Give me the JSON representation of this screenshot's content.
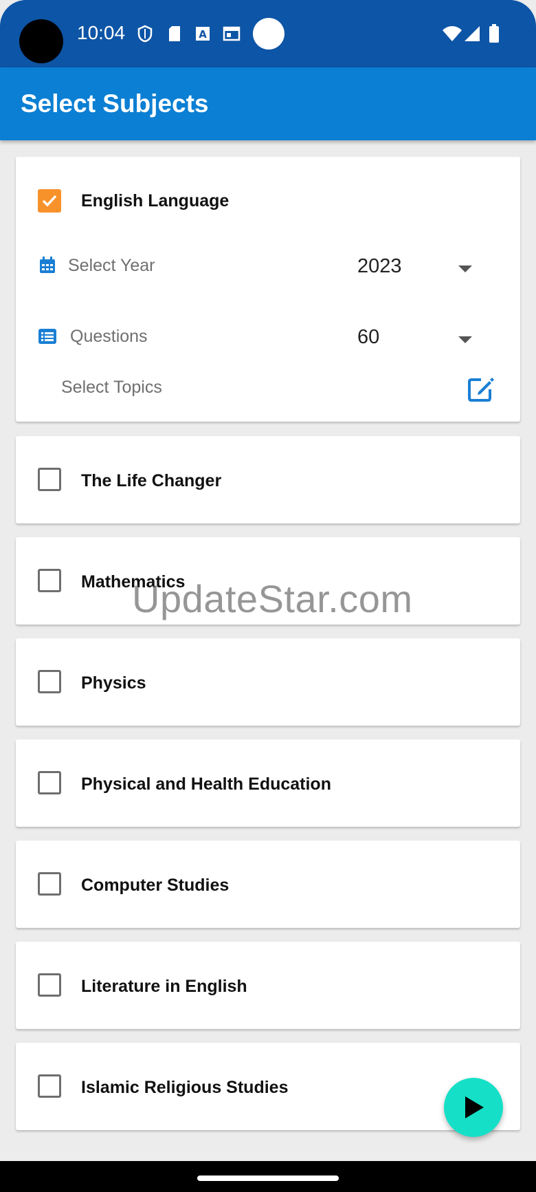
{
  "status_bar": {
    "time": "10:04",
    "icons": [
      "shield-icon",
      "sd-card-icon",
      "font-icon",
      "calendar-panel-icon",
      "wifi-icon",
      "signal-icon",
      "battery-icon"
    ]
  },
  "app_bar": {
    "title": "Select Subjects"
  },
  "expanded_subject": {
    "label": "English Language",
    "checked": true,
    "year_label": "Select Year",
    "year_value": "2023",
    "questions_label": "Questions",
    "questions_value": "60",
    "topics_label": "Select Topics"
  },
  "subjects": [
    {
      "label": "The Life Changer",
      "checked": false
    },
    {
      "label": "Mathematics",
      "checked": false
    },
    {
      "label": "Physics",
      "checked": false
    },
    {
      "label": "Physical and Health Education",
      "checked": false
    },
    {
      "label": "Computer Studies",
      "checked": false
    },
    {
      "label": "Literature in English",
      "checked": false
    },
    {
      "label": "Islamic Religious Studies",
      "checked": false
    }
  ],
  "watermark": "UpdateStar.com",
  "colors": {
    "status_bar": "#0d55a6",
    "app_bar": "#0b7fd3",
    "checkbox_checked": "#f7922a",
    "accent_icon": "#1a7fd4",
    "fab": "#15e0c7"
  }
}
